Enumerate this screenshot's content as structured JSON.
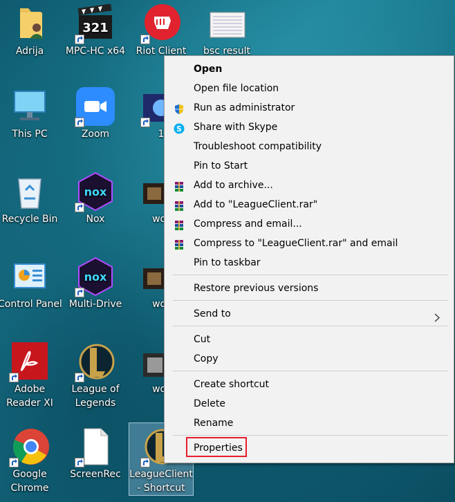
{
  "desktop": {
    "icons": [
      {
        "id": "adrija",
        "label": "Adrija",
        "icon": "user-folder-icon",
        "shortcut": false
      },
      {
        "id": "mpc",
        "label": "MPC-HC x64",
        "icon": "mpc-clapper-icon",
        "shortcut": true
      },
      {
        "id": "riot",
        "label": "Riot Client",
        "icon": "riot-fist-icon",
        "shortcut": true
      },
      {
        "id": "bsc",
        "label": "bsc result",
        "icon": "document-thumbnail-icon",
        "shortcut": false
      },
      {
        "id": "thispc",
        "label": "This PC",
        "icon": "monitor-icon",
        "shortcut": false
      },
      {
        "id": "zoom",
        "label": "Zoom",
        "icon": "zoom-camera-icon",
        "shortcut": true
      },
      {
        "id": "col3row2",
        "label": "1",
        "icon": "video-thumbnail-icon",
        "shortcut": true
      },
      {
        "id": "recycle",
        "label": "Recycle Bin",
        "icon": "recycle-bin-icon",
        "shortcut": false
      },
      {
        "id": "nox",
        "label": "Nox",
        "icon": "nox-icon",
        "shortcut": true
      },
      {
        "id": "wor1",
        "label": "wor",
        "icon": "video-thumbnail-icon",
        "shortcut": false
      },
      {
        "id": "control",
        "label": "Control Panel",
        "icon": "control-panel-icon",
        "shortcut": false
      },
      {
        "id": "multidrive",
        "label": "Multi-Drive",
        "icon": "nox-icon",
        "shortcut": true
      },
      {
        "id": "wor2",
        "label": "wor",
        "icon": "video-thumbnail-icon",
        "shortcut": false
      },
      {
        "id": "adobe",
        "label": "Adobe Reader XI",
        "icon": "adobe-reader-icon",
        "shortcut": true
      },
      {
        "id": "lol",
        "label": "League of Legends",
        "icon": "league-icon",
        "shortcut": true
      },
      {
        "id": "wor3",
        "label": "wor",
        "icon": "video-thumbnail-icon",
        "shortcut": false
      },
      {
        "id": "chrome",
        "label": "Google Chrome",
        "icon": "chrome-icon",
        "shortcut": true
      },
      {
        "id": "screenrec",
        "label": "ScreenRec",
        "icon": "blank-file-icon",
        "shortcut": true
      },
      {
        "id": "leagueclient",
        "label": "LeagueClient - Shortcut",
        "icon": "league-icon",
        "shortcut": true
      }
    ]
  },
  "context_menu": {
    "items": [
      {
        "label": "Open",
        "bold": true,
        "icon": ""
      },
      {
        "label": "Open file location",
        "icon": ""
      },
      {
        "label": "Run as administrator",
        "icon": "uac-shield-icon"
      },
      {
        "label": "Share with Skype",
        "icon": "skype-icon"
      },
      {
        "label": "Troubleshoot compatibility",
        "icon": ""
      },
      {
        "label": "Pin to Start",
        "icon": ""
      },
      {
        "label": "Add to archive...",
        "icon": "winrar-icon"
      },
      {
        "label": "Add to \"LeagueClient.rar\"",
        "icon": "winrar-icon"
      },
      {
        "label": "Compress and email...",
        "icon": "winrar-icon"
      },
      {
        "label": "Compress to \"LeagueClient.rar\" and email",
        "icon": "winrar-icon"
      },
      {
        "label": "Pin to taskbar",
        "icon": ""
      },
      {
        "label": "Restore previous versions",
        "icon": ""
      },
      {
        "label": "Send to",
        "icon": "",
        "submenu": true
      },
      {
        "label": "Cut",
        "icon": ""
      },
      {
        "label": "Copy",
        "icon": ""
      },
      {
        "label": "Create shortcut",
        "icon": ""
      },
      {
        "label": "Delete",
        "icon": ""
      },
      {
        "label": "Rename",
        "icon": ""
      },
      {
        "label": "Properties",
        "icon": "",
        "highlighted": true
      }
    ]
  }
}
